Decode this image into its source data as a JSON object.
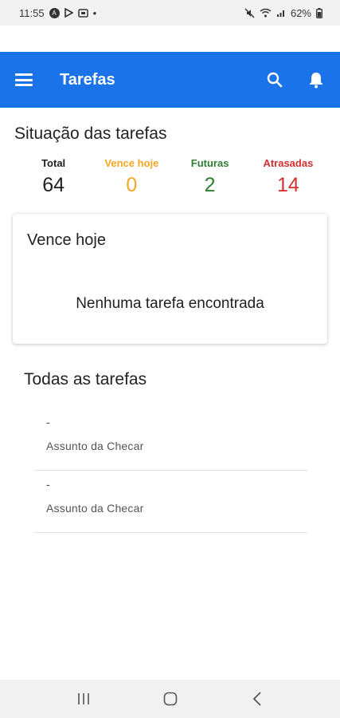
{
  "status_bar": {
    "time": "11:55",
    "dot": "•",
    "battery": "62%",
    "icons": [
      "notification-app-icon",
      "play-store-icon",
      "screenshot-icon",
      "mute-icon",
      "wifi-icon",
      "signal-icon",
      "battery-icon"
    ]
  },
  "app_bar": {
    "title": "Tarefas",
    "background": "#1a73e8",
    "icons": [
      "menu-icon",
      "search-icon",
      "bell-icon"
    ]
  },
  "summary": {
    "title": "Situação das tarefas",
    "stats": [
      {
        "label": "Total",
        "value": "64",
        "color": "#1f1f1f"
      },
      {
        "label": "Vence hoje",
        "value": "0",
        "color": "#f5a623"
      },
      {
        "label": "Futuras",
        "value": "2",
        "color": "#2e7d32"
      },
      {
        "label": "Atrasadas",
        "value": "14",
        "color": "#d32f2f"
      }
    ]
  },
  "due_today": {
    "title": "Vence hoje",
    "empty_message": "Nenhuma tarefa encontrada"
  },
  "all_tasks": {
    "title": "Todas as tarefas",
    "items": [
      {
        "name": "-",
        "subject": "Assunto da Checar"
      },
      {
        "name": "-",
        "subject": "Assunto da Checar"
      }
    ]
  },
  "nav_bar": {
    "icons": [
      "recents-icon",
      "home-icon",
      "back-icon"
    ]
  }
}
